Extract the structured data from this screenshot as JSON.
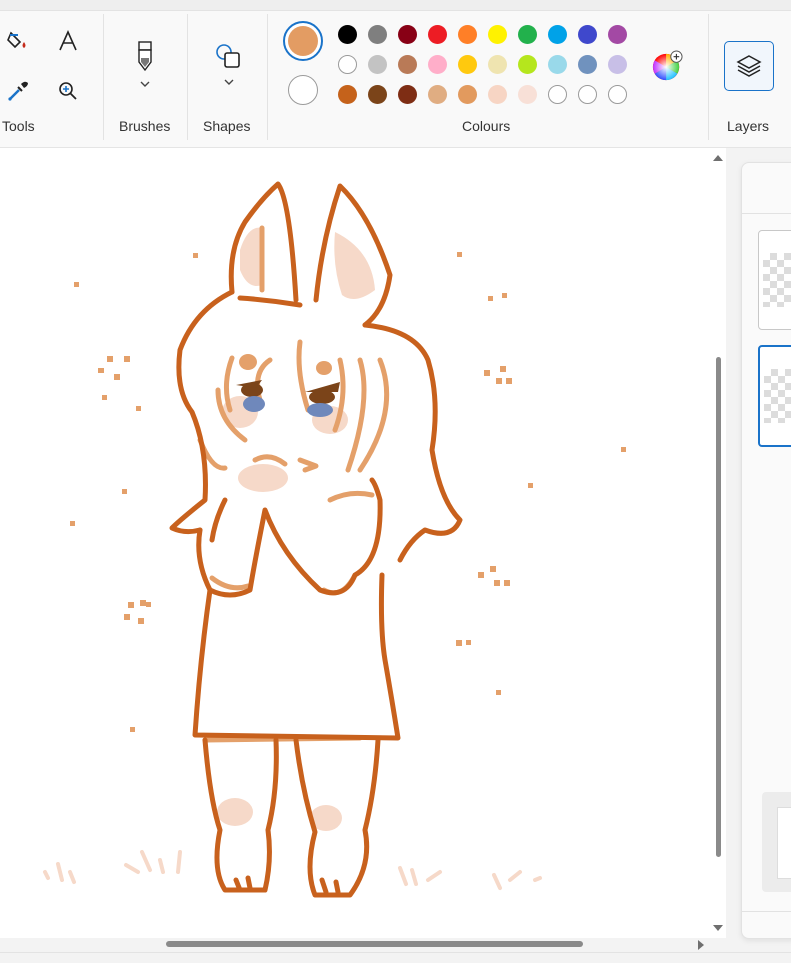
{
  "ribbon": {
    "groups": {
      "tools": "Tools",
      "brushes": "Brushes",
      "shapes": "Shapes",
      "colours": "Colours",
      "layers": "Layers"
    }
  },
  "colors": {
    "primary": "#e39c63",
    "secondary": "#ffffff",
    "palette_row1": [
      "#000000",
      "#7f7f7f",
      "#880015",
      "#ed1c24",
      "#ff7f27",
      "#fff200",
      "#22b14c",
      "#00a2e8",
      "#3f48cc",
      "#a349a4"
    ],
    "palette_row2": [
      "#ffffff",
      "#c3c3c3",
      "#b97a57",
      "#ffaec9",
      "#ffc90e",
      "#efe4b0",
      "#b5e61d",
      "#99d9ea",
      "#7092be",
      "#c8bfe7"
    ],
    "palette_row3": [
      "#c5621b",
      "#7b4419",
      "#7e2d14",
      "#e0ad82",
      "#e29a5e",
      "#f7d5c4",
      "#f8e0d7",
      "#ffffff",
      "#ffffff",
      "#ffffff"
    ]
  },
  "icons": {
    "fill": "paint-bucket-icon",
    "text": "text-icon",
    "picker": "color-picker-icon",
    "zoom": "magnifier-icon",
    "brush": "brush-icon",
    "shape": "shapes-icon",
    "edit_colours": "colour-wheel-icon",
    "layers": "layers-icon"
  },
  "drawing": {
    "outline_color": "#c8611d",
    "skin_color": "#e4a06a",
    "blush_color": "#f6d9c9",
    "eye_color": "#7b4419",
    "iris_color": "#6f88bb"
  }
}
